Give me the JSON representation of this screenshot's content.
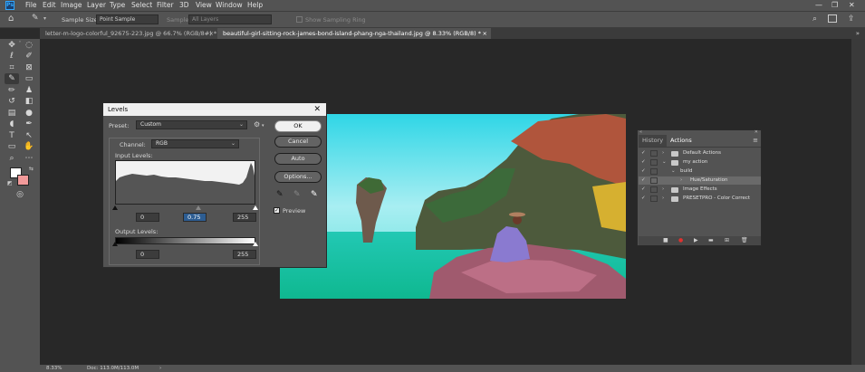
{
  "app": {
    "logo": "Ps"
  },
  "menu": [
    "File",
    "Edit",
    "Image",
    "Layer",
    "Type",
    "Select",
    "Filter",
    "3D",
    "View",
    "Window",
    "Help"
  ],
  "window_controls": {
    "minimize": "—",
    "restore": "❐",
    "close": "✕"
  },
  "options_bar": {
    "sample_size_label": "Sample Size:",
    "sample_size_value": "Point Sample",
    "sample_label": "Sample:",
    "sample_value": "All Layers",
    "show_ring_label": "Show Sampling Ring"
  },
  "tabs": [
    {
      "label": "letter-m-logo-colorful_92675-223.jpg @ 66.7% (RGB/8#) *",
      "close": "×"
    },
    {
      "label": "beautiful-girl-sitting-rock-james-bond-island-phang-nga-thailand.jpg @ 8.33% (RGB/8) *",
      "close": "×"
    }
  ],
  "tab_overflow": "»",
  "levels": {
    "title": "Levels",
    "close": "✕",
    "preset_label": "Preset:",
    "preset_value": "Custom",
    "channel_label": "Channel:",
    "channel_value": "RGB",
    "input_levels_label": "Input Levels:",
    "input_black": "0",
    "input_gamma": "0.75",
    "input_white": "255",
    "output_levels_label": "Output Levels:",
    "output_black": "0",
    "output_white": "255",
    "buttons": {
      "ok": "OK",
      "cancel": "Cancel",
      "auto": "Auto",
      "options": "Options..."
    },
    "preview_label": "Preview",
    "preview_checked": true
  },
  "actions_panel": {
    "tab_history": "History",
    "tab_actions": "Actions",
    "collapse": "«",
    "close": "✕",
    "menu": "≡",
    "rows": [
      {
        "name": "Default Actions",
        "type": "set"
      },
      {
        "name": "my action",
        "type": "set"
      },
      {
        "name": "build",
        "type": "action"
      },
      {
        "name": "Hue/Saturation",
        "type": "step"
      },
      {
        "name": "Image Effects",
        "type": "set"
      },
      {
        "name": "PRESETPRO - Color Correct",
        "type": "set"
      }
    ]
  },
  "status": {
    "zoom": "8.33%",
    "doc": "Doc: 113.0M/113.0M"
  },
  "colors": {
    "accent": "#31a8ff",
    "foreground": "#ffffff",
    "background": "#f29a9a",
    "record": "#e0312f"
  }
}
